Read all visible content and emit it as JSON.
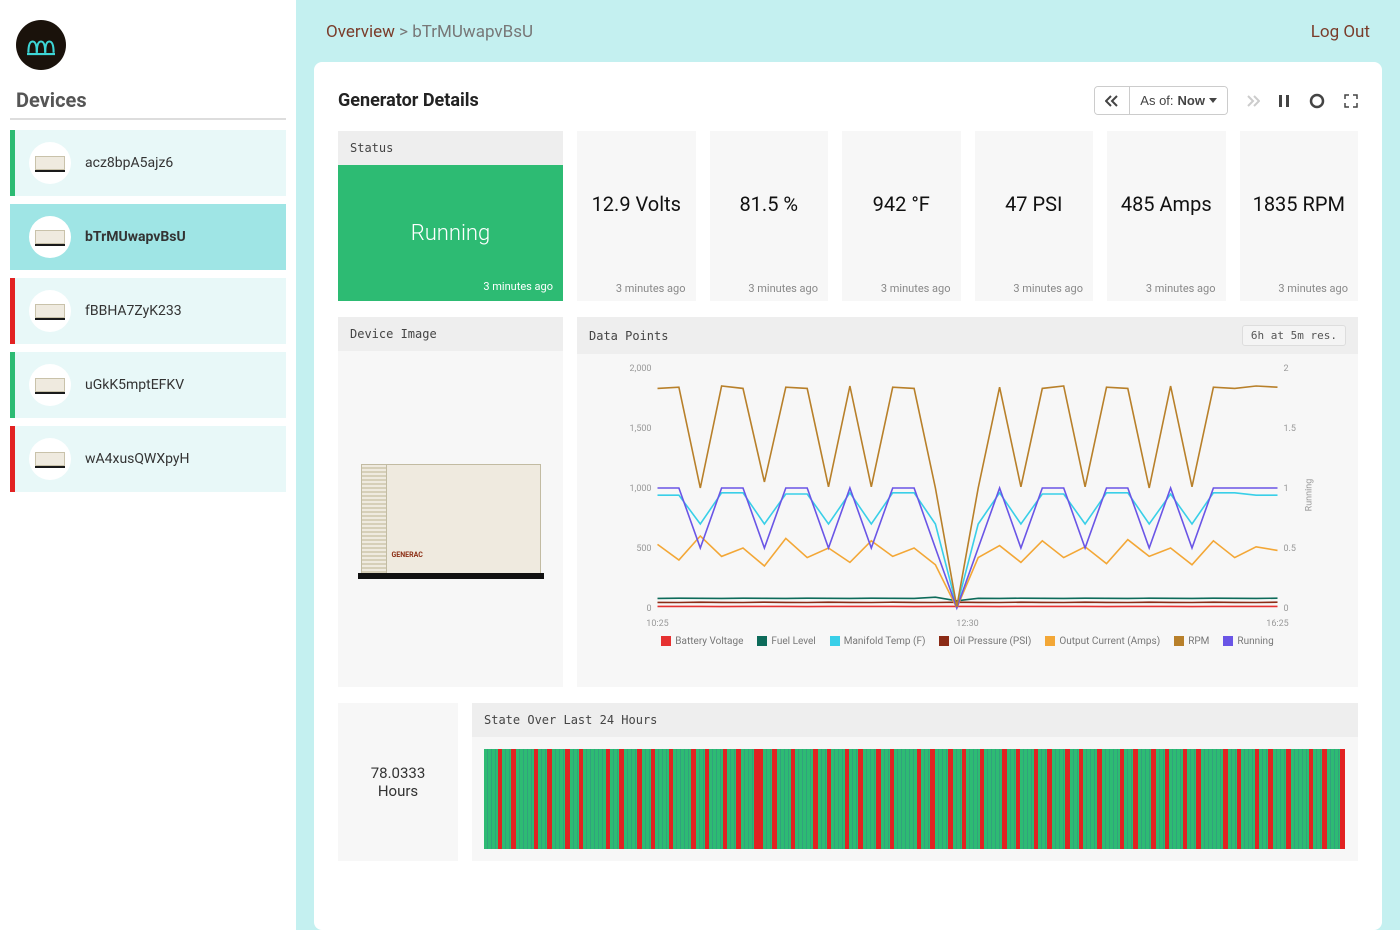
{
  "sidebar": {
    "header": "Devices",
    "devices": [
      {
        "id": "acz8bpA5ajz6",
        "status": "green",
        "active": false
      },
      {
        "id": "bTrMUwapvBsU",
        "status": "green",
        "active": true
      },
      {
        "id": "fBBHA7ZyK233",
        "status": "red",
        "active": false
      },
      {
        "id": "uGkK5mptEFKV",
        "status": "green",
        "active": false
      },
      {
        "id": "wA4xusQWXpyH",
        "status": "red",
        "active": false
      }
    ]
  },
  "breadcrumb": {
    "root": "Overview",
    "sep": ">",
    "leaf": "bTrMUwapvBsU"
  },
  "logout": "Log Out",
  "page": {
    "title": "Generator Details",
    "asof_prefix": "As of:",
    "asof_value": "Now"
  },
  "status": {
    "header": "Status",
    "value": "Running",
    "ago": "3 minutes ago"
  },
  "stats": [
    {
      "value": "12.9 Volts",
      "ago": "3 minutes ago"
    },
    {
      "value": "81.5 %",
      "ago": "3 minutes ago"
    },
    {
      "value": "942 °F",
      "ago": "3 minutes ago"
    },
    {
      "value": "47 PSI",
      "ago": "3 minutes ago"
    },
    {
      "value": "485 Amps",
      "ago": "3 minutes ago"
    },
    {
      "value": "1835 RPM",
      "ago": "3 minutes ago"
    }
  ],
  "device_image": {
    "header": "Device Image",
    "brand": "GENERAC"
  },
  "chart": {
    "header": "Data Points",
    "badge": "6h at 5m res."
  },
  "chart_data": {
    "type": "line",
    "xlabel": "",
    "ylabel_left": "",
    "ylabel_right": "Running",
    "x_ticks": [
      "10:25",
      "12:30",
      "16:25"
    ],
    "y_left_ticks": [
      0,
      500,
      1000,
      1500,
      2000
    ],
    "y_right_ticks": [
      0,
      0.5,
      1,
      1.5,
      2
    ],
    "y_left_range": [
      0,
      2000
    ],
    "y_right_range": [
      0,
      2
    ],
    "legend": [
      {
        "name": "Battery Voltage",
        "color": "#e63131"
      },
      {
        "name": "Fuel Level",
        "color": "#0d6b5a"
      },
      {
        "name": "Manifold Temp (F)",
        "color": "#39cfe8"
      },
      {
        "name": "Oil Pressure (PSI)",
        "color": "#8b2b16"
      },
      {
        "name": "Output Current (Amps)",
        "color": "#f3a736"
      },
      {
        "name": "RPM",
        "color": "#b8802a"
      },
      {
        "name": "Running",
        "color": "#6a55e6"
      }
    ],
    "series": [
      {
        "name": "Battery Voltage",
        "color": "#e63131",
        "axis": "left",
        "y": [
          13,
          13,
          13,
          12,
          13,
          13,
          13,
          12,
          13,
          13,
          13,
          13,
          12,
          13,
          13,
          13,
          12,
          13,
          13,
          13,
          13,
          12,
          13,
          13,
          13,
          12,
          13,
          13,
          13,
          13
        ]
      },
      {
        "name": "Fuel Level",
        "color": "#0d6b5a",
        "axis": "left",
        "y": [
          80,
          82,
          81,
          80,
          82,
          81,
          80,
          82,
          81,
          80,
          82,
          81,
          80,
          90,
          60,
          81,
          80,
          82,
          81,
          80,
          82,
          81,
          80,
          82,
          81,
          80,
          82,
          81,
          80,
          82
        ]
      },
      {
        "name": "Oil Pressure (PSI)",
        "color": "#8b2b16",
        "axis": "left",
        "y": [
          47,
          46,
          48,
          47,
          46,
          48,
          47,
          46,
          48,
          47,
          46,
          48,
          47,
          46,
          48,
          47,
          46,
          48,
          47,
          46,
          48,
          47,
          46,
          48,
          47,
          46,
          48,
          47,
          46,
          48
        ]
      },
      {
        "name": "Output Current (Amps)",
        "color": "#f3a736",
        "axis": "left",
        "y": [
          530,
          400,
          600,
          430,
          500,
          350,
          580,
          420,
          500,
          380,
          560,
          430,
          500,
          360,
          0,
          420,
          520,
          380,
          560,
          420,
          510,
          370,
          570,
          430,
          500,
          360,
          560,
          420,
          510,
          480
        ]
      },
      {
        "name": "Manifold Temp (F)",
        "color": "#39cfe8",
        "axis": "left",
        "y": [
          940,
          940,
          700,
          960,
          960,
          700,
          950,
          950,
          700,
          960,
          700,
          960,
          960,
          700,
          10,
          700,
          960,
          700,
          950,
          950,
          700,
          960,
          960,
          700,
          950,
          700,
          960,
          960,
          940,
          940
        ]
      },
      {
        "name": "Running",
        "color": "#6a55e6",
        "axis": "right",
        "y": [
          1,
          1,
          0.5,
          1,
          1,
          0.5,
          1,
          1,
          0.5,
          1,
          0.5,
          1,
          1,
          0.5,
          0,
          0.5,
          1,
          0.5,
          1,
          1,
          0.5,
          1,
          1,
          0.5,
          1,
          0.5,
          1,
          1,
          1,
          1
        ]
      },
      {
        "name": "RPM",
        "color": "#b8802a",
        "axis": "left",
        "y": [
          1830,
          1840,
          1000,
          1850,
          1830,
          1050,
          1840,
          1830,
          1010,
          1850,
          1010,
          1840,
          1830,
          1000,
          10,
          1000,
          1840,
          1010,
          1830,
          1850,
          1010,
          1840,
          1830,
          1000,
          1850,
          1010,
          1840,
          1830,
          1850,
          1840
        ]
      }
    ]
  },
  "hours": {
    "value": "78.0333",
    "label": "Hours"
  },
  "state24": {
    "header": "State Over Last 24 Hours",
    "colors": {
      "running": "#2dbb73",
      "stripe": "#31a27c",
      "fault": "#e22222"
    },
    "segments": [
      3,
      1,
      2,
      1,
      4,
      1,
      2,
      1,
      3,
      1,
      2,
      1,
      5,
      1,
      2,
      1,
      3,
      1,
      2,
      1,
      3,
      1,
      4,
      1,
      2,
      1,
      3,
      1,
      2,
      1,
      3,
      2,
      2,
      1,
      3,
      1,
      4,
      1,
      2,
      1,
      3,
      1,
      2,
      1,
      3,
      1,
      2,
      1,
      5,
      1,
      2,
      1,
      3,
      1,
      2,
      1,
      3,
      1,
      4,
      1,
      2,
      1,
      3,
      1,
      2,
      1,
      3,
      1,
      2,
      1,
      3,
      1,
      4,
      1,
      2,
      1,
      3,
      1,
      2,
      1,
      3,
      1,
      2,
      1,
      5,
      1,
      2,
      1,
      3,
      1,
      2,
      1,
      3,
      1,
      4,
      1,
      2,
      1,
      3,
      1
    ]
  }
}
